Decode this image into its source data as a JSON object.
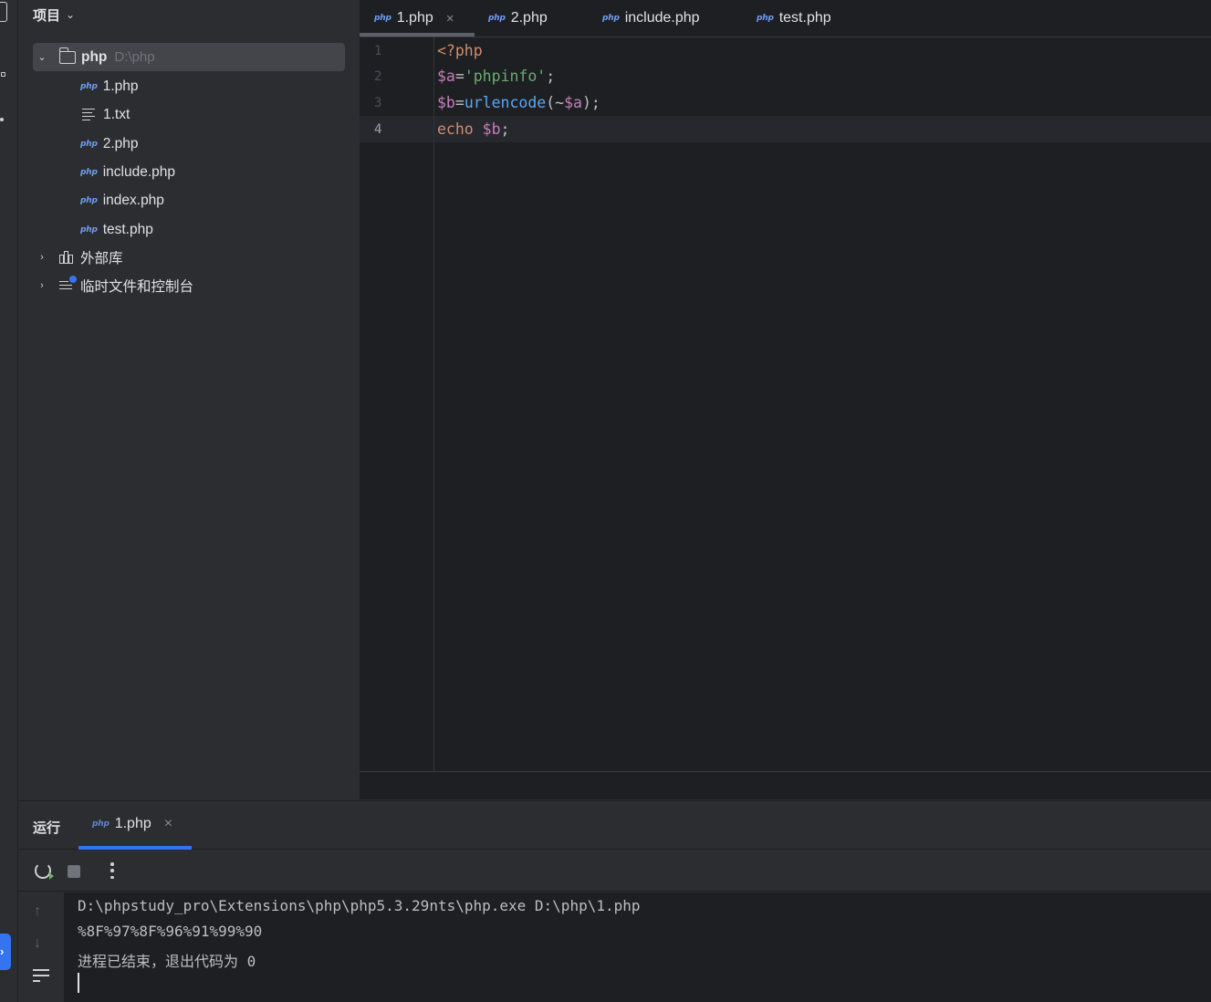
{
  "project_panel": {
    "title": "项目",
    "root": {
      "name": "php",
      "path": "D:\\php"
    },
    "files": [
      {
        "name": "1.php",
        "type": "php"
      },
      {
        "name": "1.txt",
        "type": "txt"
      },
      {
        "name": "2.php",
        "type": "php"
      },
      {
        "name": "include.php",
        "type": "php"
      },
      {
        "name": "index.php",
        "type": "php"
      },
      {
        "name": "test.php",
        "type": "php"
      }
    ],
    "external_libs": "外部库",
    "scratches": "临时文件和控制台"
  },
  "editor": {
    "tabs": [
      {
        "label": "1.php",
        "active": true
      },
      {
        "label": "2.php",
        "active": false
      },
      {
        "label": "include.php",
        "active": false
      },
      {
        "label": "test.php",
        "active": false
      }
    ],
    "file_badge": "php",
    "line_numbers": [
      "1",
      "2",
      "3",
      "4"
    ],
    "current_line": 4,
    "code": [
      [
        {
          "t": "<?php",
          "c": "kw"
        }
      ],
      [
        {
          "t": "$a",
          "c": "var"
        },
        {
          "t": "=",
          "c": "pn"
        },
        {
          "t": "'phpinfo'",
          "c": "str"
        },
        {
          "t": ";",
          "c": "pn"
        }
      ],
      [
        {
          "t": "$b",
          "c": "var"
        },
        {
          "t": "=",
          "c": "pn"
        },
        {
          "t": "urlencode",
          "c": "fn"
        },
        {
          "t": "(~",
          "c": "pn"
        },
        {
          "t": "$a",
          "c": "var"
        },
        {
          "t": ");",
          "c": "pn"
        }
      ],
      [
        {
          "t": "echo ",
          "c": "kw"
        },
        {
          "t": "$b",
          "c": "var"
        },
        {
          "t": ";",
          "c": "pn"
        }
      ]
    ]
  },
  "run_panel": {
    "title": "运行",
    "tab_label": "1.php",
    "output": [
      "D:\\phpstudy_pro\\Extensions\\php\\php5.3.29nts\\php.exe D:\\php\\1.php",
      "%8F%97%8F%96%91%99%90",
      "进程已结束，退出代码为 0"
    ]
  },
  "colors": {
    "accent": "#3574f0",
    "php_badge": "#6e9ef5",
    "keyword": "#cf8e6d",
    "variable": "#c77dbb",
    "string": "#6aab73",
    "function": "#56a8f5"
  },
  "close_glyph": "×",
  "up_arrow": "↑",
  "down_arrow": "↓"
}
